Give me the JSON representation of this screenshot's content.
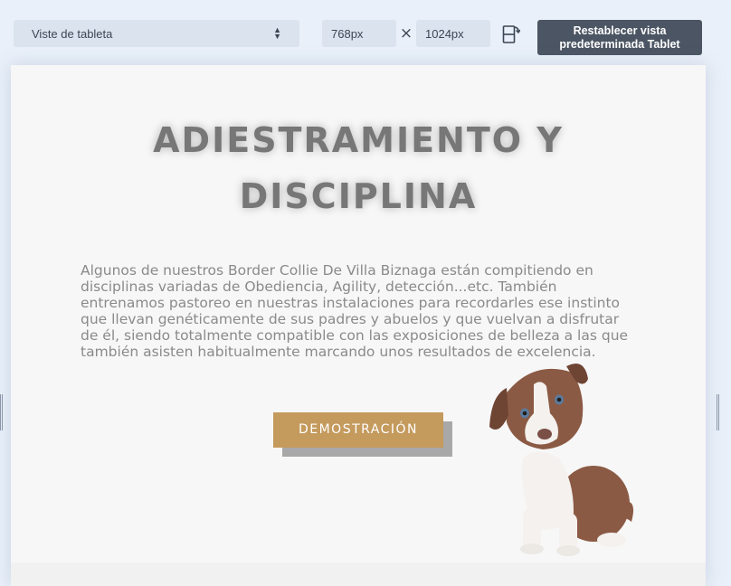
{
  "toolbar": {
    "device_select": {
      "value": "Viste de tableta"
    },
    "width_value": "768px",
    "height_value": "1024px",
    "reset_label_line1": "Restablecer vista",
    "reset_label_line2": "predeterminada Tablet"
  },
  "hero": {
    "title_line1": "ADIESTRAMIENTO Y",
    "title_line2": "DISCIPLINA",
    "paragraph": "Algunos de nuestros Border Collie De Villa Biznaga están compitiendo en disciplinas variadas de Obediencia, Agility, detección...etc. También entrenamos pastoreo en nuestras instalaciones para recordarles ese instinto que llevan genéticamente de sus padres y abuelos y que vuelvan a disfrutar de él, siendo totalmente compatible con las exposiciones de belleza a las que también asisten habitualmente marcando unos resultados de excelencia.",
    "button_label": "DEMOSTRACIÓN"
  },
  "colors": {
    "toolbar_bg": "#e9f0f9",
    "input_bg": "#dbe3ee",
    "reset_button_bg": "#4b5563",
    "accent_gold": "#c49a5d",
    "title_gray": "#777777"
  },
  "icons": {
    "select_arrows": "updown-arrows-icon",
    "times": "times-icon",
    "rotate": "rotate-device-icon"
  }
}
